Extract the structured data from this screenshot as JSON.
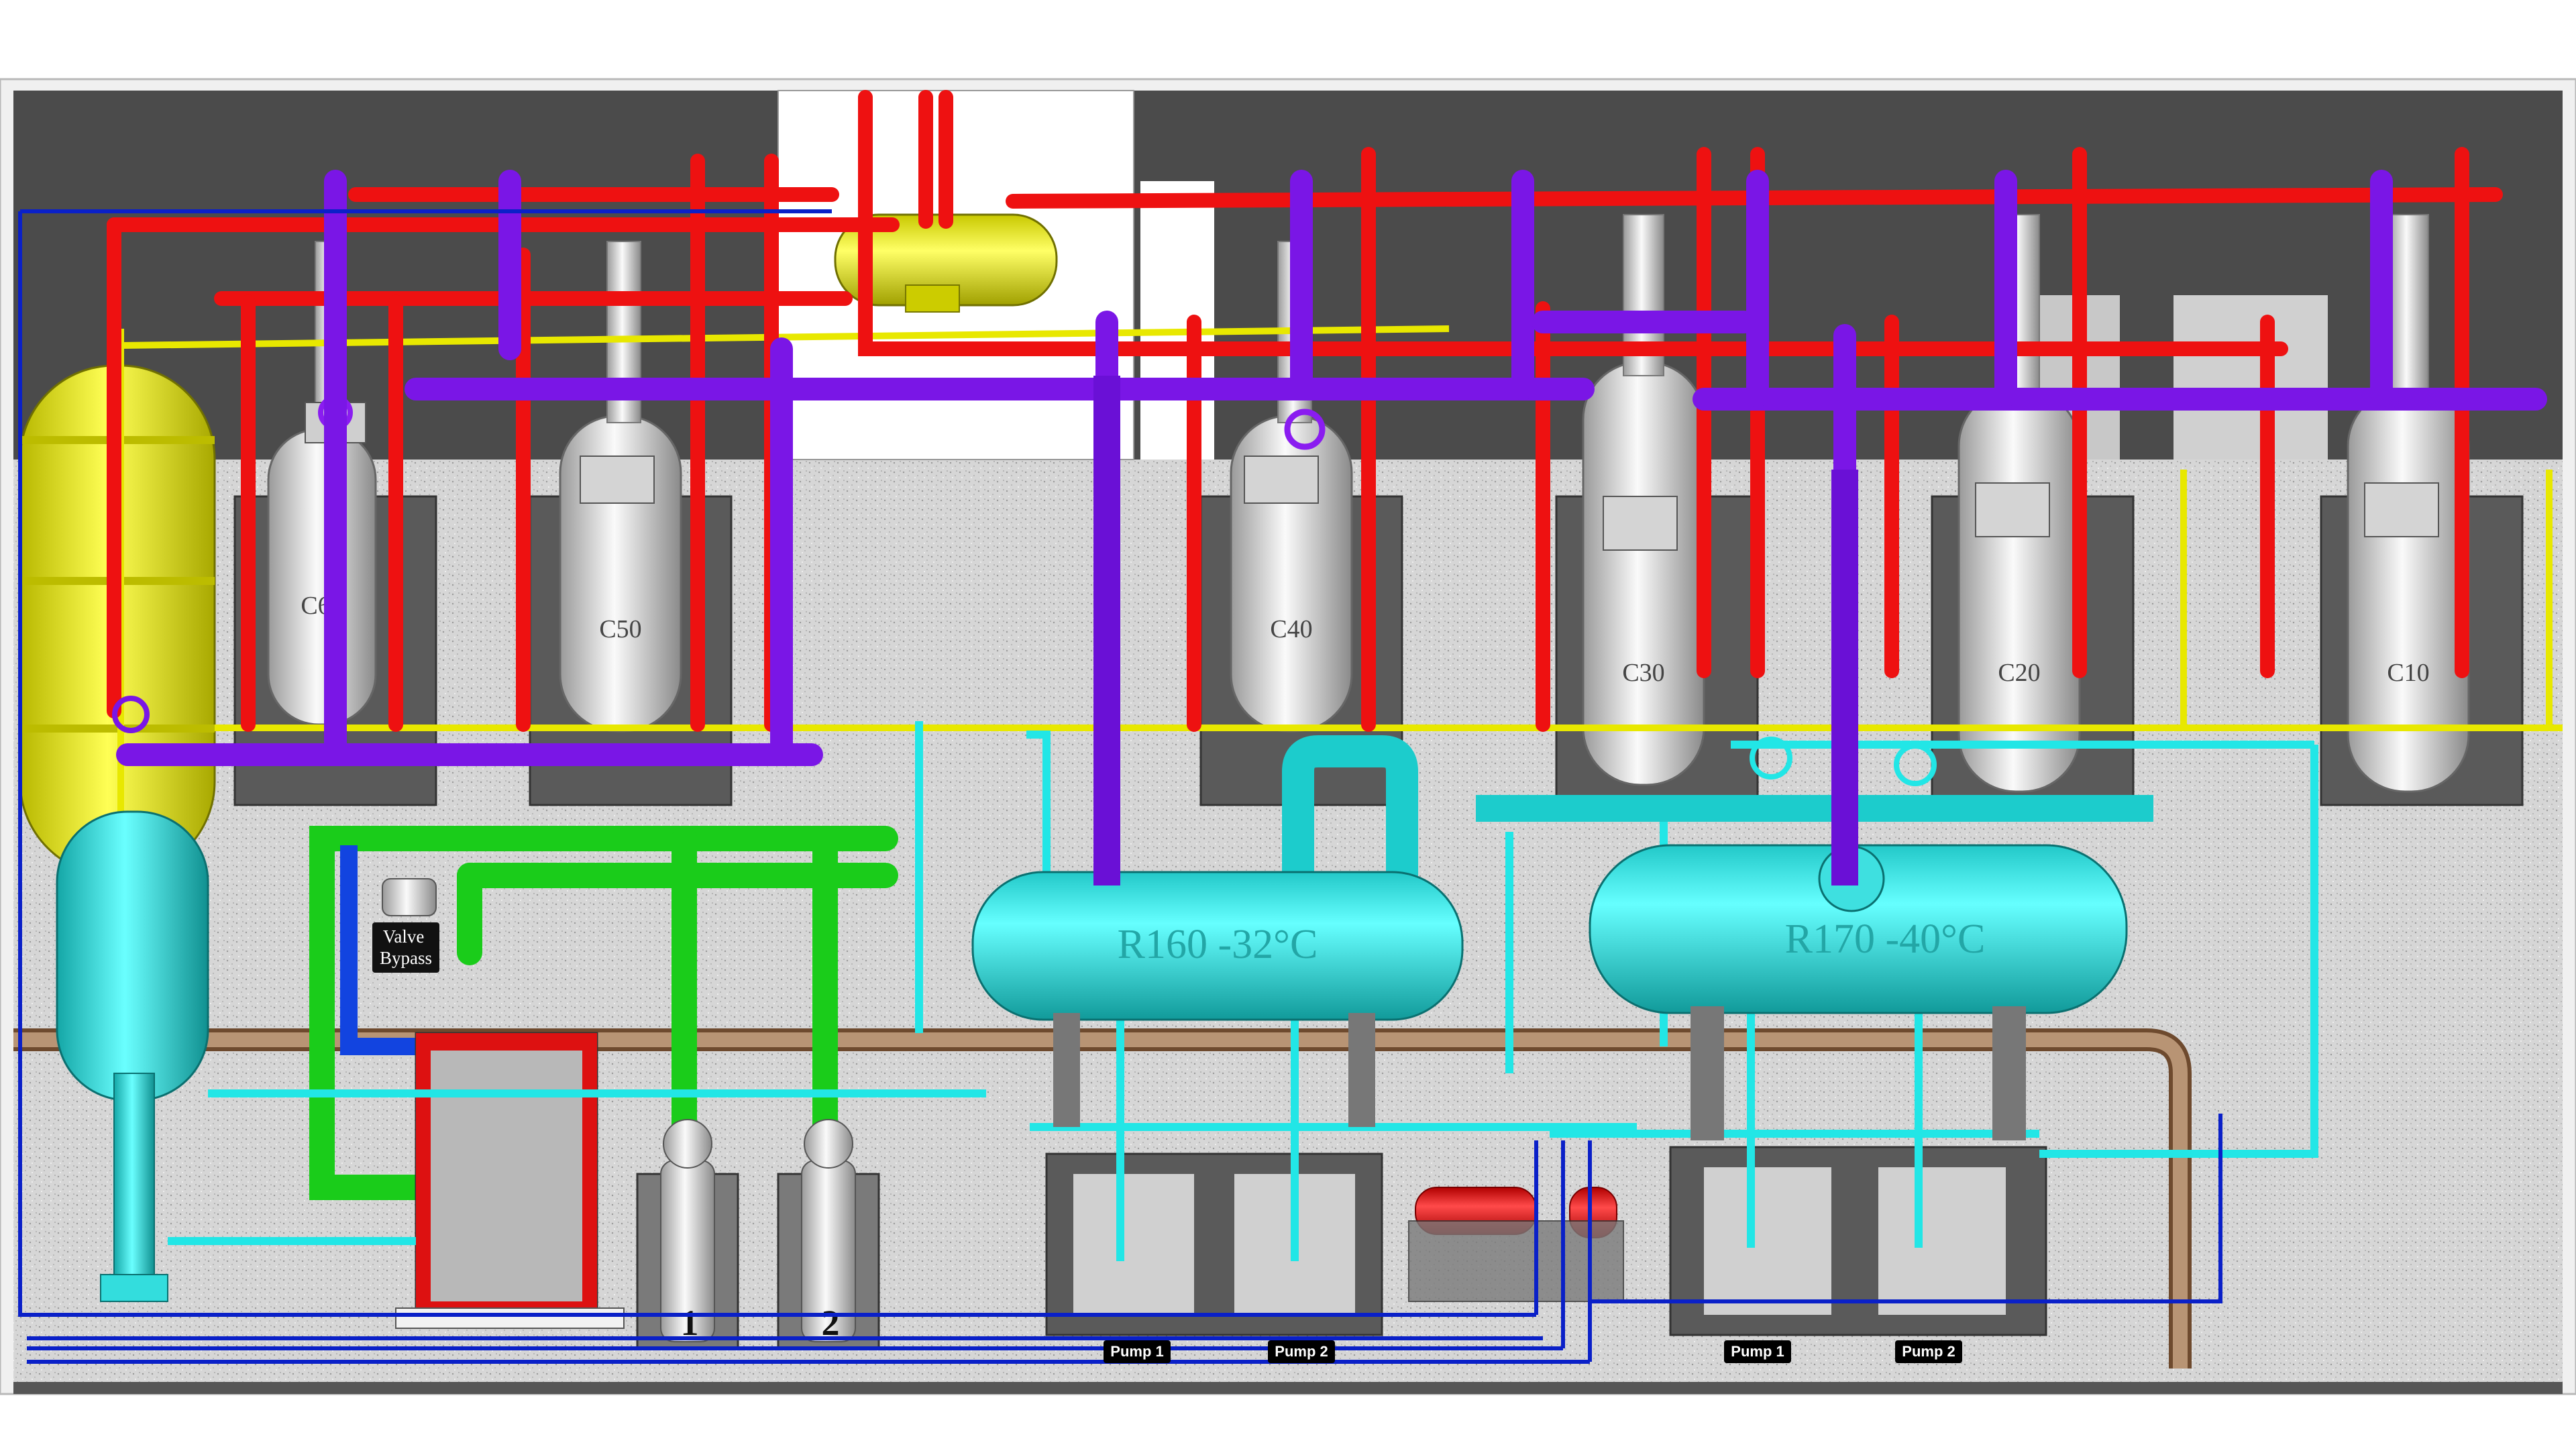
{
  "colors": {
    "hot_gas": "#ff1a1a",
    "suction": "#8a1cf0",
    "liquid": "#ffff22",
    "glycol": "#22ee22",
    "brine": "#1a4fe8",
    "separator": "#22f0f0",
    "control": "#1024c8",
    "drain": "#b08a6a",
    "floor": "#d9d9d9",
    "wall": "#4a4a4a"
  },
  "compressors": [
    {
      "id": "c60",
      "label": "C60"
    },
    {
      "id": "c50",
      "label": "C50"
    },
    {
      "id": "c40",
      "label": "C40"
    },
    {
      "id": "c30",
      "label": "C30"
    },
    {
      "id": "c20",
      "label": "C20"
    },
    {
      "id": "c10",
      "label": "C10"
    }
  ],
  "vessels": {
    "r160": "R160 -32°C",
    "r170": "R170 -40°C"
  },
  "valve_bypass": "Valve Bypass",
  "pump_numbers": [
    "1",
    "2"
  ],
  "pump_labels": {
    "r160_pump1": "Pump 1",
    "r160_pump2": "Pump 2",
    "r170_pump1": "Pump 1",
    "r170_pump2": "Pump 2"
  }
}
